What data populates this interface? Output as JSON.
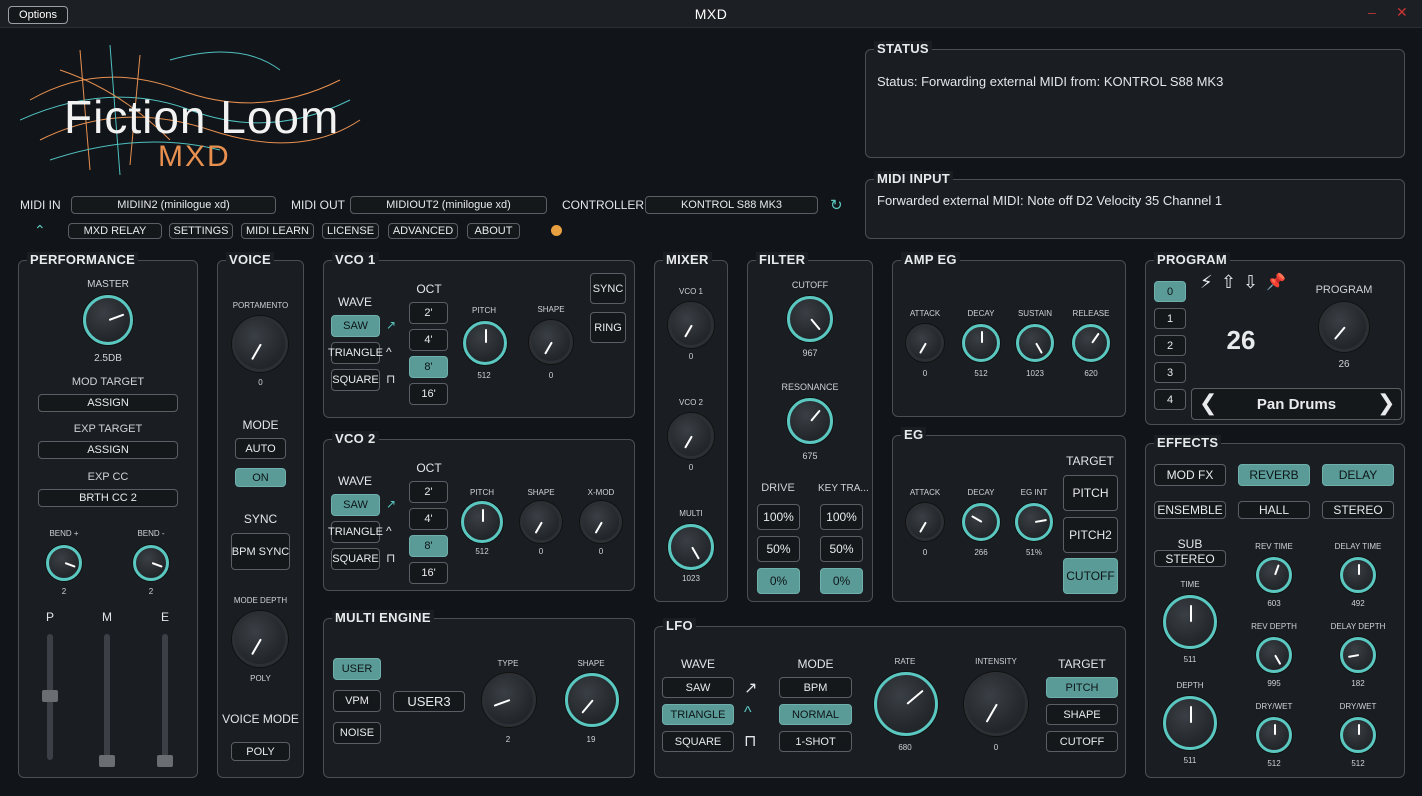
{
  "window": {
    "options": "Options",
    "title": "MXD"
  },
  "logo": {
    "name": "Fiction Loom",
    "sub": "MXD"
  },
  "midi": {
    "in_label": "MIDI IN",
    "in_value": "MIDIIN2 (minilogue xd)",
    "out_label": "MIDI OUT",
    "out_value": "MIDIOUT2 (minilogue xd)",
    "ctrl_label": "CONTROLLER",
    "ctrl_value": "KONTROL S88 MK3"
  },
  "toolbar": [
    "MXD RELAY",
    "SETTINGS",
    "MIDI LEARN",
    "LICENSE",
    "ADVANCED",
    "ABOUT"
  ],
  "status": {
    "title": "STATUS",
    "text": "Status: Forwarding external MIDI from: KONTROL S88 MK3"
  },
  "midi_input": {
    "title": "MIDI INPUT",
    "text": "Forwarded external MIDI: Note off D2 Velocity 35 Channel 1"
  },
  "performance": {
    "title": "PERFORMANCE",
    "master": "MASTER",
    "master_val": "2.5DB",
    "mod_target": "MOD TARGET",
    "mod_btn": "ASSIGN",
    "exp_target": "EXP TARGET",
    "exp_btn": "ASSIGN",
    "exp_cc": "EXP CC",
    "exp_cc_val": "BRTH CC 2",
    "bend_plus": "BEND +",
    "bend_plus_val": "2",
    "bend_minus": "BEND -",
    "bend_minus_val": "2",
    "p": "P",
    "m": "M",
    "e": "E"
  },
  "voice": {
    "title": "VOICE",
    "portamento": "PORTAMENTO",
    "porta_val": "0",
    "mode": "MODE",
    "auto": "AUTO",
    "on": "ON",
    "sync": "SYNC",
    "bpm_sync": "BPM SYNC",
    "mode_depth": "MODE DEPTH",
    "depth_val": "POLY",
    "voice_mode": "VOICE MODE",
    "voice_mode_val": "POLY"
  },
  "vco1": {
    "title": "VCO 1",
    "wave": "WAVE",
    "oct": "OCT",
    "waves": [
      "SAW",
      "TRIANGLE",
      "SQUARE"
    ],
    "octs": [
      "2'",
      "4'",
      "8'",
      "16'"
    ],
    "pitch": "PITCH",
    "pitch_val": "512",
    "shape": "SHAPE",
    "shape_val": "0",
    "sync": "SYNC",
    "ring": "RING"
  },
  "vco2": {
    "title": "VCO 2",
    "wave": "WAVE",
    "oct": "OCT",
    "waves": [
      "SAW",
      "TRIANGLE",
      "SQUARE"
    ],
    "octs": [
      "2'",
      "4'",
      "8'",
      "16'"
    ],
    "pitch": "PITCH",
    "pitch_val": "512",
    "shape": "SHAPE",
    "shape_val": "0",
    "xmod": "X-MOD",
    "xmod_val": "0"
  },
  "multi": {
    "title": "MULTI ENGINE",
    "user": "USER",
    "vpm": "VPM",
    "noise": "NOISE",
    "user3": "USER3",
    "type": "TYPE",
    "type_val": "2",
    "shape": "SHAPE",
    "shape_val": "19"
  },
  "mixer": {
    "title": "MIXER",
    "vco1": "VCO 1",
    "vco1_val": "0",
    "vco2": "VCO 2",
    "vco2_val": "0",
    "multi": "MULTI",
    "multi_val": "1023"
  },
  "filter": {
    "title": "FILTER",
    "cutoff": "CUTOFF",
    "cutoff_val": "967",
    "resonance": "RESONANCE",
    "res_val": "675",
    "drive": "DRIVE",
    "keytrack": "KEY TRA...",
    "drive_vals": [
      "100%",
      "50%",
      "0%"
    ],
    "kt_vals": [
      "100%",
      "50%",
      "0%"
    ]
  },
  "amp_eg": {
    "title": "AMP EG",
    "attack": "ATTACK",
    "attack_val": "0",
    "decay": "DECAY",
    "decay_val": "512",
    "sustain": "SUSTAIN",
    "sustain_val": "1023",
    "release": "RELEASE",
    "release_val": "620"
  },
  "eg": {
    "title": "EG",
    "attack": "ATTACK",
    "attack_val": "0",
    "decay": "DECAY",
    "decay_val": "266",
    "egint": "EG INT",
    "egint_val": "51%",
    "target": "TARGET",
    "targets": [
      "PITCH",
      "PITCH2",
      "CUTOFF"
    ]
  },
  "lfo": {
    "title": "LFO",
    "wave": "WAVE",
    "waves": [
      "SAW",
      "TRIANGLE",
      "SQUARE"
    ],
    "mode": "MODE",
    "modes": [
      "BPM",
      "NORMAL",
      "1-SHOT"
    ],
    "rate": "RATE",
    "rate_val": "680",
    "intensity": "INTENSITY",
    "int_val": "0",
    "target": "TARGET",
    "targets": [
      "PITCH",
      "SHAPE",
      "CUTOFF"
    ]
  },
  "program": {
    "title": "PROGRAM",
    "slots": [
      "0",
      "1",
      "2",
      "3",
      "4"
    ],
    "number": "26",
    "label": "PROGRAM",
    "knob_val": "26",
    "name": "Pan Drums"
  },
  "effects": {
    "title": "EFFECTS",
    "modfx": "MOD FX",
    "reverb": "REVERB",
    "delay": "DELAY",
    "ensemble": "ENSEMBLE",
    "hall": "HALL",
    "stereo": "STEREO",
    "sub": "SUB",
    "sub_val": "STEREO",
    "time": "TIME",
    "time_val": "511",
    "depth": "DEPTH",
    "depth_val": "511",
    "rev_time": "REV TIME",
    "rev_time_val": "603",
    "delay_time": "DELAY TIME",
    "delay_time_val": "492",
    "rev_depth": "REV DEPTH",
    "rev_depth_val": "995",
    "delay_depth": "DELAY DEPTH",
    "delay_depth_val": "182",
    "drywet1": "DRY/WET",
    "drywet1_val": "512",
    "drywet2": "DRY/WET",
    "drywet2_val": "512"
  }
}
